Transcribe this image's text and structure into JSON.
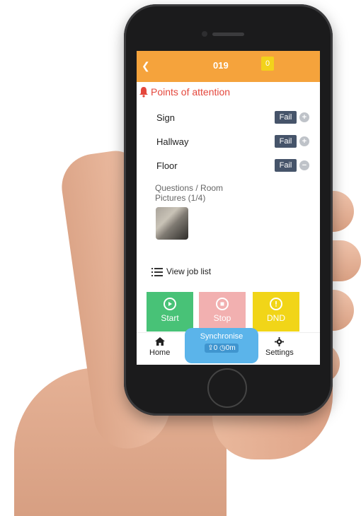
{
  "header": {
    "title": "019",
    "badge_count": "0"
  },
  "section": {
    "title": "Points of attention"
  },
  "items": [
    {
      "label": "Sign",
      "status": "Fail",
      "toggle": "plus"
    },
    {
      "label": "Hallway",
      "status": "Fail",
      "toggle": "plus"
    },
    {
      "label": "Floor",
      "status": "Fail",
      "toggle": "minus"
    }
  ],
  "questions": {
    "line1": "Questions / Room",
    "line2": "Pictures (1/4)"
  },
  "view_job_list": "View job list",
  "actions": {
    "start": "Start",
    "stop": "Stop",
    "dnd": "DND"
  },
  "nav": {
    "home": "Home",
    "settings": "Settings"
  },
  "sync": {
    "label": "Synchronise",
    "uploads": "0",
    "duration": "0m"
  },
  "colors": {
    "header": "#f5a33c",
    "badge": "#f2d21b",
    "attention": "#e4473c",
    "fail": "#46546a",
    "start": "#48c277",
    "stop": "#f2b0b0",
    "dnd": "#f1d518",
    "sync": "#5bb4ea"
  }
}
